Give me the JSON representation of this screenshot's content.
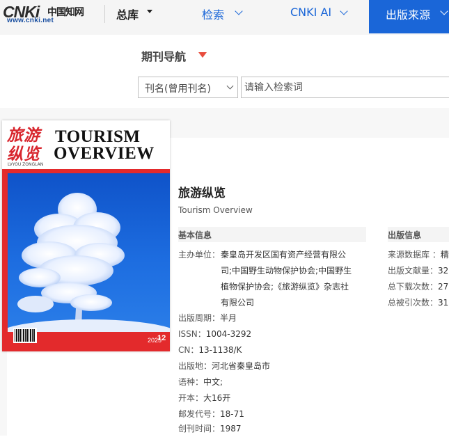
{
  "header": {
    "logo_text": "CNKi",
    "logo_cn": "中国知网",
    "logo_url": "www.cnki.net",
    "nav": {
      "zongku": "总库",
      "jiansuo": "检索",
      "cnki_ai": "CNKI AI",
      "chuban": "出版来源"
    }
  },
  "search": {
    "nav_title": "期刊导航",
    "field_select": "刊名(曾用刊名)",
    "placeholder": "请输入检索词"
  },
  "cover": {
    "cn_title": "旅游纵览",
    "pinyin": "LVYOU ZONGLAN",
    "en_line1": "TOURISM",
    "en_line2": "OVERVIEW",
    "year": "2025",
    "issue": "12"
  },
  "journal": {
    "title": "旅游纵览",
    "en_title": "Tourism Overview"
  },
  "basic": {
    "header": "基本信息",
    "sponsor_label": "主办单位：",
    "sponsor_lines": [
      "秦皇岛开发区国有资产经营有限公",
      "司;中国野生动物保护协会;中国野生",
      "植物保护协会;《旅游纵览》杂志社",
      "有限公司"
    ],
    "rows": [
      {
        "k": "出版周期：",
        "v": "半月"
      },
      {
        "k": "ISSN：",
        "v": "1004-3292"
      },
      {
        "k": "CN：",
        "v": "13-1138/K"
      },
      {
        "k": "出版地：",
        "v": "河北省秦皇岛市"
      },
      {
        "k": "语种：",
        "v": "中文;"
      },
      {
        "k": "开本：",
        "v": "大16开"
      },
      {
        "k": "邮发代号：",
        "v": "18-71"
      },
      {
        "k": "创刊时间：",
        "v": "1987"
      }
    ]
  },
  "pubinfo": {
    "header": "出版信息",
    "rows": [
      {
        "k": "来源数据库 ：",
        "v": "精"
      },
      {
        "k": "出版文献量：",
        "v": "32"
      },
      {
        "k": "总下载次数：",
        "v": "27"
      },
      {
        "k": "总被引次数：",
        "v": "31"
      }
    ]
  }
}
